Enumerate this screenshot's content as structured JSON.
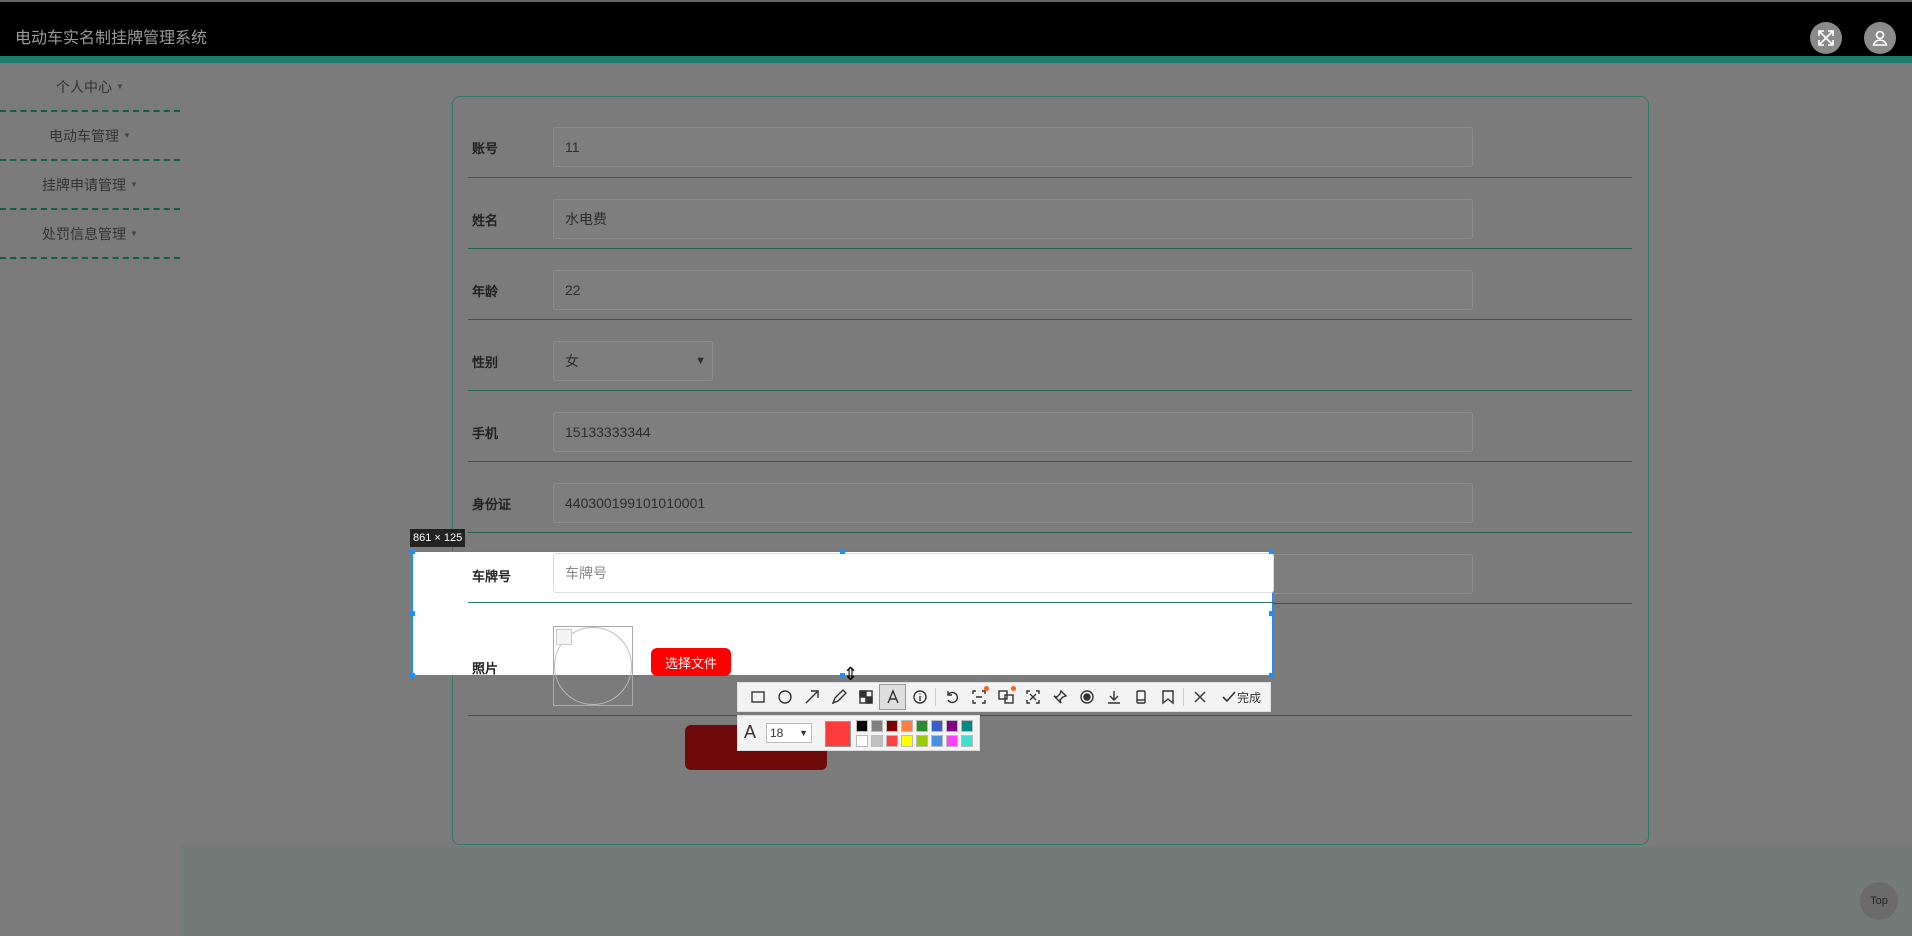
{
  "header": {
    "title": "电动车实名制挂牌管理系统"
  },
  "sidebar": {
    "items": [
      {
        "label": "个人中心"
      },
      {
        "label": "电动车管理"
      },
      {
        "label": "挂牌申请管理"
      },
      {
        "label": "处罚信息管理"
      }
    ]
  },
  "form": {
    "account": {
      "label": "账号",
      "value": "11"
    },
    "name": {
      "label": "姓名",
      "value": "水电费"
    },
    "age": {
      "label": "年龄",
      "value": "22"
    },
    "gender": {
      "label": "性别",
      "value": "女"
    },
    "phone": {
      "label": "手机",
      "value": "15133333344"
    },
    "idcard": {
      "label": "身份证",
      "value": "440300199101010001"
    },
    "plate": {
      "label": "车牌号",
      "placeholder": "车牌号"
    },
    "photo": {
      "label": "照片",
      "choose_label": "选择文件"
    }
  },
  "selection": {
    "size_label": "861 × 125"
  },
  "toolbar": {
    "done_label": "完成",
    "font_size": "18",
    "current_color": "#ff3b3b",
    "palette": [
      "#000000",
      "#808080",
      "#800000",
      "#ff8040",
      "#2d8a2d",
      "#3a5fcd",
      "#800080",
      "#008b8b",
      "#ffffff",
      "#c0c0c0",
      "#ff4040",
      "#ffff00",
      "#99cc00",
      "#4a90e2",
      "#ff40ff",
      "#40e0d0"
    ]
  },
  "top_button": {
    "label": "Top"
  }
}
